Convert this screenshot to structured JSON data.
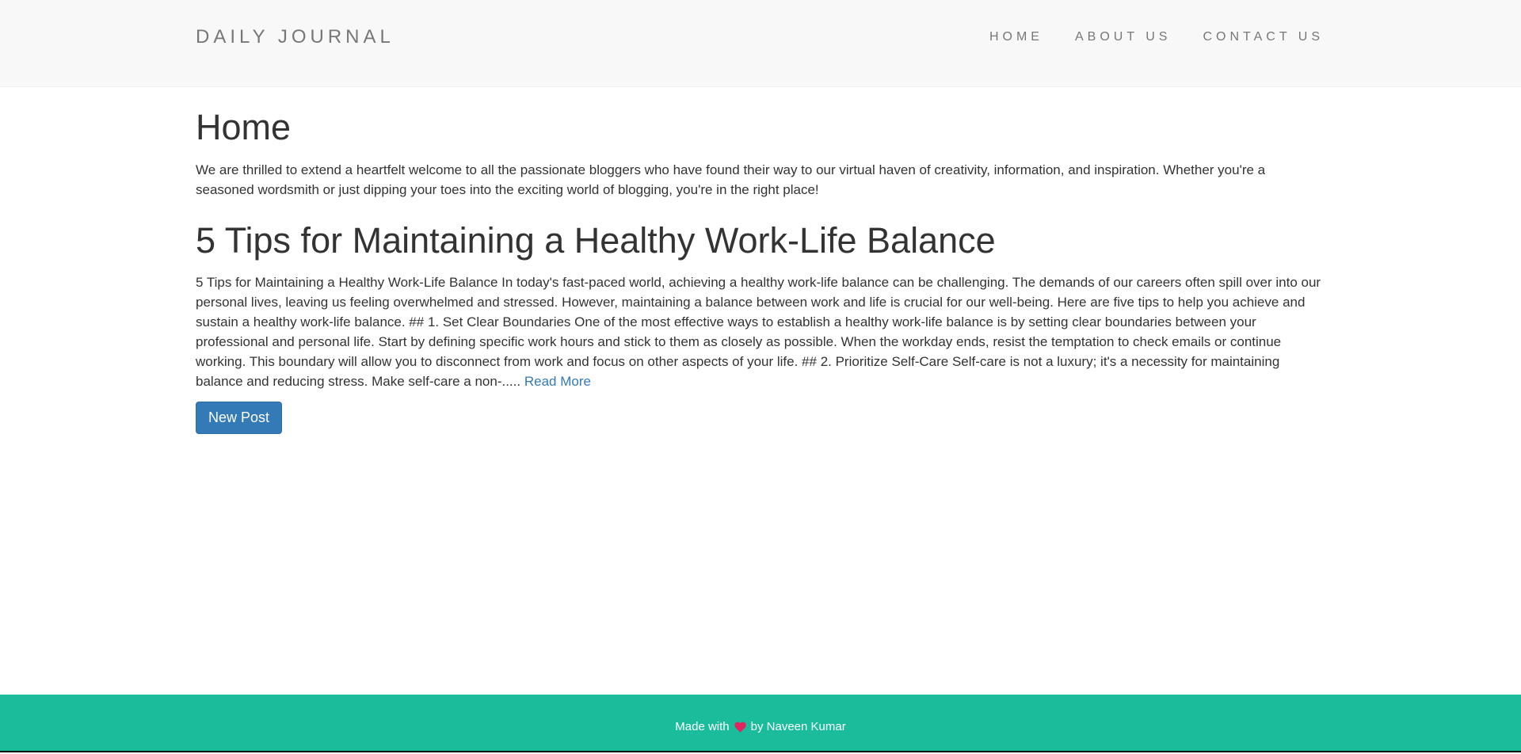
{
  "navbar": {
    "brand": "DAILY JOURNAL",
    "links": [
      {
        "label": "HOME"
      },
      {
        "label": "ABOUT US"
      },
      {
        "label": "CONTACT US"
      }
    ]
  },
  "home": {
    "title": "Home",
    "intro": "We are thrilled to extend a heartfelt welcome to all the passionate bloggers who have found their way to our virtual haven of creativity, information, and inspiration. Whether you're a seasoned wordsmith or just dipping your toes into the exciting world of blogging, you're in the right place!"
  },
  "post": {
    "title": "5 Tips for Maintaining a Healthy Work-Life Balance",
    "excerpt": "5 Tips for Maintaining a Healthy Work-Life Balance In today's fast-paced world, achieving a healthy work-life balance can be challenging. The demands of our careers often spill over into our personal lives, leaving us feeling overwhelmed and stressed. However, maintaining a balance between work and life is crucial for our well-being. Here are five tips to help you achieve and sustain a healthy work-life balance. ## 1. Set Clear Boundaries One of the most effective ways to establish a healthy work-life balance is by setting clear boundaries between your professional and personal life. Start by defining specific work hours and stick to them as closely as possible. When the workday ends, resist the temptation to check emails or continue working. This boundary will allow you to disconnect from work and focus on other aspects of your life. ## 2. Prioritize Self-Care Self-care is not a luxury; it's a necessity for maintaining balance and reducing stress. Make self-care a non-.....",
    "read_more": "Read More"
  },
  "actions": {
    "new_post": "New Post"
  },
  "footer": {
    "made_with": "Made with",
    "by": "by Naveen Kumar",
    "heart_icon": "heart-icon"
  },
  "colors": {
    "footer_bg": "#1abc9c",
    "primary": "#337ab7",
    "navbar_bg": "#f8f8f8"
  }
}
